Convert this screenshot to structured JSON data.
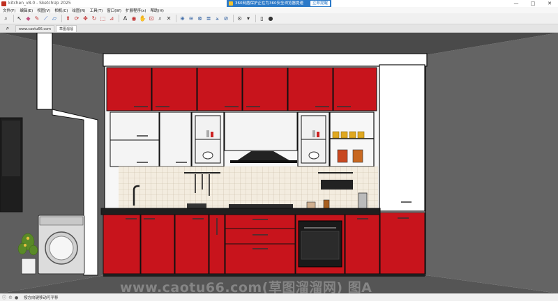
{
  "window": {
    "title": "kitchen_v8.0 - SketchUp 2025",
    "controls": {
      "minimize": "—",
      "maximize": "□",
      "close": "✕"
    }
  },
  "notification": {
    "text": "360网盾保护正在为360安全浏览器提速",
    "action": "立即提醒"
  },
  "menubar": {
    "items": [
      "文件(F)",
      "编辑(E)",
      "视图(V)",
      "相机(C)",
      "绘图(R)",
      "工具(T)",
      "窗口(W)",
      "扩展程序(x)",
      "帮助(H)"
    ]
  },
  "toolbar": {
    "icons": [
      "zoom-icon",
      "select-icon",
      "eraser-icon",
      "pencil-icon",
      "line-icon",
      "shape-icon",
      "push-pull-icon",
      "offset-icon",
      "move-icon",
      "rotate-icon",
      "scale-icon",
      "tape-icon",
      "text-icon",
      "paint-icon",
      "orbit-icon",
      "pan-icon",
      "zoom-window-icon",
      "zoom-extents-icon",
      "warehouse-icon",
      "sandbox-icon",
      "extension-icon",
      "section-icon",
      "layers-icon",
      "outliner-icon",
      "styles-icon",
      "settings-icon",
      "new-file-icon",
      "user-icon"
    ]
  },
  "tabs": {
    "items": [
      "www.caotu66.com",
      "草图溜溜"
    ]
  },
  "watermark": "www.caotu66.com(草图溜溜网) 图A",
  "statusbar": {
    "text": "按方向键移动可平移"
  },
  "colors": {
    "cabinet_red": "#c8141c",
    "wall_gray": "#5f5f5f",
    "cabinet_white": "#f4f4f4",
    "countertop": "#1f1f1f"
  }
}
